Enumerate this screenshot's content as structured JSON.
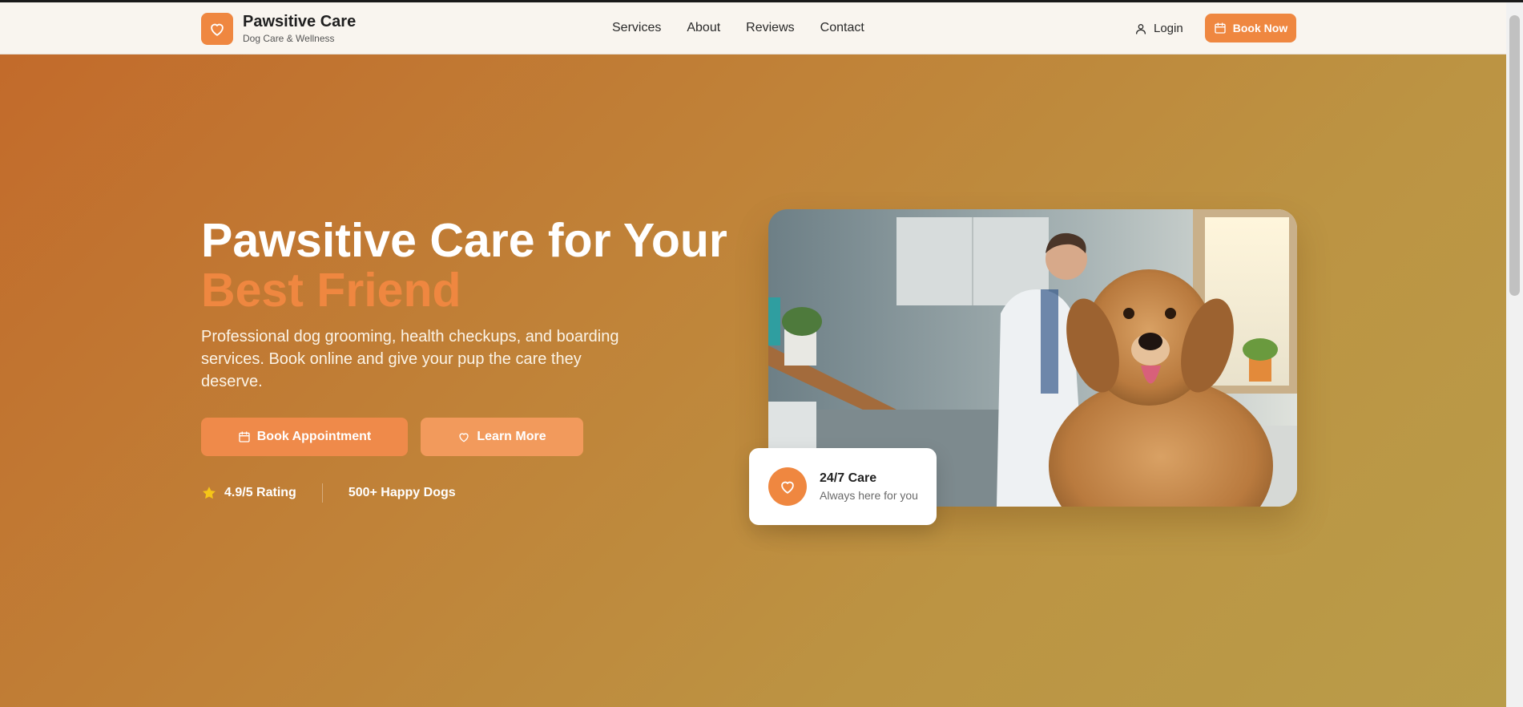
{
  "header": {
    "brand_name": "Pawsitive Care",
    "brand_tagline": "Dog Care & Wellness",
    "nav": [
      "Services",
      "About",
      "Reviews",
      "Contact"
    ],
    "login_label": "Login",
    "book_now_label": "Book Now"
  },
  "hero": {
    "title_line1": "Pawsitive Care for Your",
    "title_line2": "Best Friend",
    "description": "Professional dog grooming, health checkups, and boarding services. Book online and give your pup the care they deserve.",
    "primary_button": "Book Appointment",
    "secondary_button": "Learn More",
    "rating": "4.9/5 Rating",
    "happy_dogs": "500+ Happy Dogs"
  },
  "care_card": {
    "title": "24/7 Care",
    "subtitle": "Always here for you"
  },
  "colors": {
    "accent": "#ef8740",
    "header_bg": "#f9f5ef",
    "hero_gradient_start": "#c2692a",
    "hero_gradient_end": "#b99c49",
    "star": "#f5c518"
  },
  "icons": {
    "brand": "heart-icon",
    "login": "user-icon",
    "book_now": "calendar-icon",
    "primary_button": "calendar-icon",
    "secondary_button": "heart-icon",
    "rating": "star-icon",
    "care_card": "heart-icon"
  }
}
